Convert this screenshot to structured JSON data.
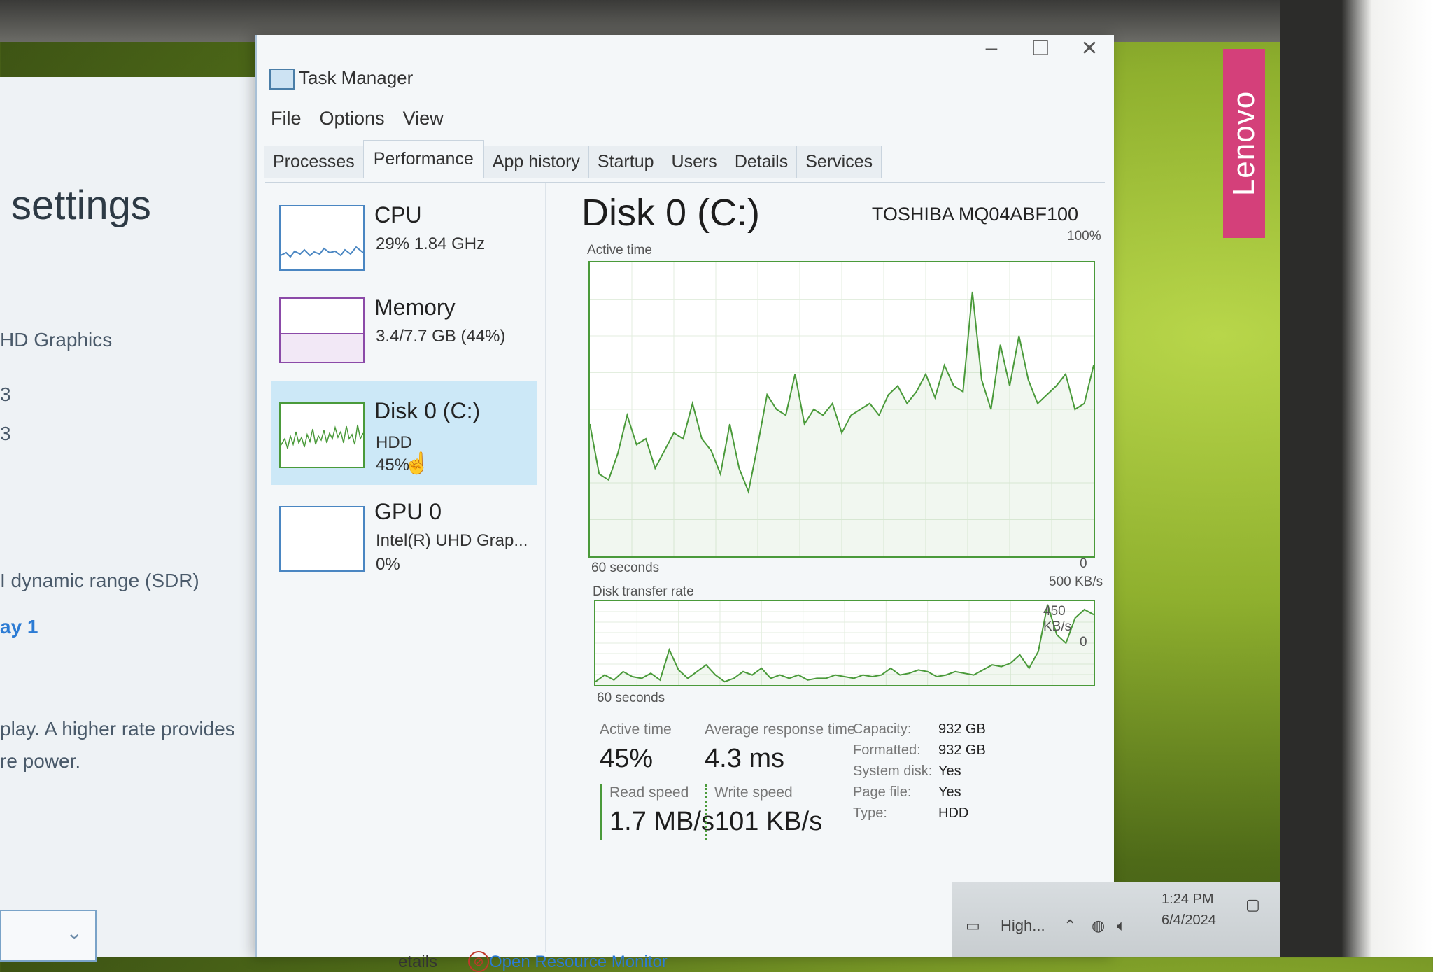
{
  "brand": {
    "laptop_logo": "Lenovo"
  },
  "settings_window": {
    "title": "settings",
    "lines": [
      "HD Graphics",
      "3",
      "3",
      "I dynamic range (SDR)"
    ],
    "link": "ay 1",
    "description_line1": "play. A higher rate provides",
    "description_line2": "re power."
  },
  "task_manager": {
    "title": "Task Manager",
    "window_controls": {
      "minimize": "–",
      "maximize": "☐",
      "close": "✕"
    },
    "menu": [
      "File",
      "Options",
      "View"
    ],
    "tabs": [
      "Processes",
      "Performance",
      "App history",
      "Startup",
      "Users",
      "Details",
      "Services"
    ],
    "active_tab": "Performance",
    "resources": [
      {
        "name": "CPU",
        "line1": "29%  1.84 GHz",
        "line2": ""
      },
      {
        "name": "Memory",
        "line1": "3.4/7.7 GB (44%)",
        "line2": ""
      },
      {
        "name": "Disk 0 (C:)",
        "line1": "HDD",
        "line2": "45%",
        "selected": true
      },
      {
        "name": "GPU 0",
        "line1": "Intel(R) UHD Grap...",
        "line2": "0%"
      }
    ],
    "detail": {
      "title": "Disk 0 (C:)",
      "model": "TOSHIBA MQ04ABF100",
      "active_time_chart": {
        "label": "Active time",
        "max_label": "100%",
        "min_label": "0",
        "time_label": "60 seconds"
      },
      "transfer_chart": {
        "label": "Disk transfer rate",
        "max_label": "500 KB/s",
        "secondary_label": "450 KB/s",
        "min_label": "0",
        "time_label": "60 seconds"
      },
      "stats": {
        "active_time_label": "Active time",
        "active_time_value": "45%",
        "avg_response_label": "Average response time",
        "avg_response_value": "4.3 ms",
        "read_speed_label": "Read speed",
        "read_speed_value": "1.7 MB/s",
        "write_speed_label": "Write speed",
        "write_speed_value": "101 KB/s"
      },
      "properties": [
        {
          "label": "Capacity:",
          "value": "932 GB"
        },
        {
          "label": "Formatted:",
          "value": "932 GB"
        },
        {
          "label": "System disk:",
          "value": "Yes"
        },
        {
          "label": "Page file:",
          "value": "Yes"
        },
        {
          "label": "Type:",
          "value": "HDD"
        }
      ]
    },
    "footer": {
      "details_label": "etails",
      "resource_monitor_link": "Open Resource Monitor"
    }
  },
  "taskbar": {
    "power_label": "High...",
    "time": "1:24 PM",
    "date": "6/4/2024"
  },
  "chart_data": [
    {
      "type": "line",
      "title": "Active time",
      "ylim": [
        0,
        100
      ],
      "x": [
        "60 seconds",
        "0"
      ],
      "series": [
        {
          "values": [
            45,
            28,
            26,
            35,
            48,
            38,
            40,
            30,
            36,
            42,
            40,
            52,
            40,
            36,
            28,
            45,
            30,
            22,
            38,
            55,
            50,
            48,
            62,
            45,
            50,
            48,
            52,
            42,
            48,
            50,
            52,
            48,
            55,
            58,
            52,
            56,
            62,
            54,
            65,
            58,
            56,
            90,
            60,
            50,
            72,
            58,
            75,
            60,
            52,
            55,
            58,
            62,
            50,
            52,
            65
          ]
        }
      ],
      "colors": [
        "#4a9a3a"
      ]
    },
    {
      "type": "line",
      "title": "Disk transfer rate",
      "ylim": [
        0,
        500
      ],
      "x": [
        "60 seconds",
        "0"
      ],
      "series": [
        {
          "values": [
            20,
            60,
            30,
            80,
            50,
            40,
            70,
            30,
            210,
            90,
            40,
            80,
            120,
            60,
            20,
            40,
            80,
            60,
            100,
            40,
            60,
            40,
            60,
            30,
            40,
            40,
            60,
            50,
            40,
            60,
            50,
            60,
            100,
            60,
            70,
            90,
            80,
            50,
            60,
            80,
            70,
            60,
            90,
            120,
            110,
            130,
            180,
            100,
            200,
            480,
            300,
            250,
            400,
            450,
            420
          ]
        }
      ],
      "colors": [
        "#4a9a3a"
      ]
    }
  ],
  "colors": {
    "accent": "#2b7bd4",
    "disk_green": "#4a9a3a",
    "selected_bg": "#cce8f7",
    "lenovo_pink": "#d4407a"
  }
}
